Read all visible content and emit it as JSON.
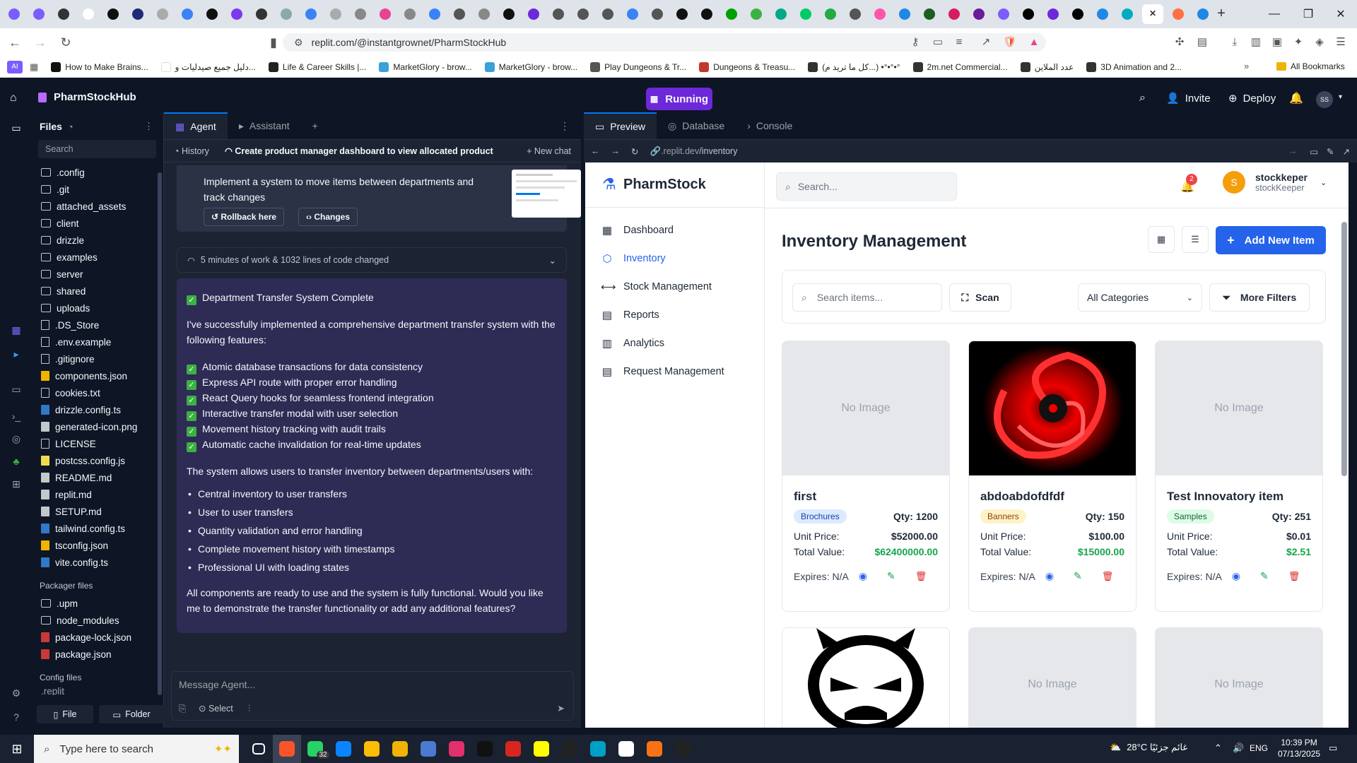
{
  "browser": {
    "url": "replit.com/@instantgrownet/PharmStockHub",
    "bookmarks": [
      {
        "label": "How to Make Brains...",
        "color": "#111"
      },
      {
        "label": "دليل جميع صيدليات و...",
        "color": "#ffffff"
      },
      {
        "label": "Life & Career Skills |...",
        "color": "#222"
      },
      {
        "label": "MarketGlory - brow...",
        "color": "#3aa0d8"
      },
      {
        "label": "MarketGlory - brow...",
        "color": "#3aa0d8"
      },
      {
        "label": "Play Dungeons & Tr...",
        "color": "#555"
      },
      {
        "label": "Dungeons & Treasu...",
        "color": "#c0392b"
      },
      {
        "label": "(كل ما تريد م...) •°•°•°",
        "color": "#333"
      },
      {
        "label": "2m.net Commercial...",
        "color": "#333"
      },
      {
        "label": "عدد الملاين",
        "color": "#333"
      },
      {
        "label": "3D Animation and 2...",
        "color": "#333"
      }
    ],
    "all_bookmarks": "All Bookmarks"
  },
  "replit": {
    "project": "PharmStockHub",
    "run_status": "Running",
    "invite": "Invite",
    "deploy": "Deploy",
    "avatar": "SS"
  },
  "files": {
    "title": "Files",
    "search_placeholder": "Search",
    "items": [
      ".config",
      ".git",
      "attached_assets",
      "client",
      "drizzle",
      "examples",
      "server",
      "shared",
      "uploads",
      ".DS_Store",
      ".env.example",
      ".gitignore",
      "components.json",
      "cookies.txt",
      "drizzle.config.ts",
      "generated-icon.png",
      "LICENSE",
      "postcss.config.js",
      "README.md",
      "replit.md",
      "SETUP.md",
      "tailwind.config.ts",
      "tsconfig.json",
      "vite.config.ts"
    ],
    "packager_title": "Packager files",
    "packager_items": [
      ".upm",
      "node_modules",
      "package-lock.json",
      "package.json"
    ],
    "config_title": "Config files",
    "config_partial": ".replit",
    "btn_file": "File",
    "btn_folder": "Folder"
  },
  "agent": {
    "tabs": [
      "Agent",
      "Assistant"
    ],
    "history": "History",
    "chat_title": "Create product manager dashboard to view allocated product...",
    "new_chat": "New chat",
    "task_text": "Implement a system to move items between departments and track changes",
    "rollback": "Rollback here",
    "changes": "Changes",
    "work_summary": "5 minutes of work & 1032 lines of code changed",
    "heading": "Department Transfer System Complete",
    "intro": "I've successfully implemented a comprehensive department transfer system with the following features:",
    "features": [
      "Atomic database transactions for data consistency",
      "Express API route with proper error handling",
      "React Query hooks for seamless frontend integration",
      "Interactive transfer modal with user selection",
      "Movement history tracking with audit trails",
      "Automatic cache invalidation for real-time updates"
    ],
    "allows": "The system allows users to transfer inventory between departments/users with:",
    "bullets": [
      "Central inventory to user transfers",
      "User to user transfers",
      "Quantity validation and error handling",
      "Complete movement history with timestamps",
      "Professional UI with loading states"
    ],
    "closing": "All components are ready to use and the system is fully functional. Would you like me to demonstrate the transfer functionality or add any additional features?",
    "input_placeholder": "Message Agent...",
    "select": "Select"
  },
  "preview": {
    "tabs": [
      "Preview",
      "Database",
      "Console"
    ],
    "url_host": ".replit.dev",
    "url_path": "/inventory"
  },
  "app": {
    "brand": "PharmStock",
    "search_placeholder": "Search...",
    "notif_count": "2",
    "user_initial": "S",
    "user_name": "stockkeper",
    "user_role": "stockKeeper",
    "nav": [
      "Dashboard",
      "Inventory",
      "Stock Management",
      "Reports",
      "Analytics",
      "Request Management"
    ],
    "page_title": "Inventory Management",
    "add_btn": "Add New Item",
    "filter_placeholder": "Search items...",
    "scan": "Scan",
    "category": "All Categories",
    "more_filters": "More Filters",
    "labels": {
      "unit": "Unit Price:",
      "total": "Total Value:",
      "expires": "Expires: N/A",
      "no_image": "No Image"
    },
    "cards": [
      {
        "name": "first",
        "category": "Brochures",
        "qty": "Qty: 1200",
        "unit": "$52000.00",
        "total": "$62400000.00",
        "badge_bg": "#dbeafe",
        "badge_fg": "#1e40af"
      },
      {
        "name": "abdoabdofdfdf",
        "category": "Banners",
        "qty": "Qty: 150",
        "unit": "$100.00",
        "total": "$15000.00",
        "badge_bg": "#fef3c7",
        "badge_fg": "#92400e"
      },
      {
        "name": "Test Innovatory item",
        "category": "Samples",
        "qty": "Qty: 251",
        "unit": "$0.01",
        "total": "$2.51",
        "badge_bg": "#dcfce7",
        "badge_fg": "#166534"
      }
    ]
  },
  "taskbar": {
    "search_placeholder": "Type here to search",
    "weather": "28°C  غائم جزئيًا",
    "lang": "ENG",
    "time": "10:39 PM",
    "date": "07/13/2025",
    "whatsapp_badge": "32"
  }
}
